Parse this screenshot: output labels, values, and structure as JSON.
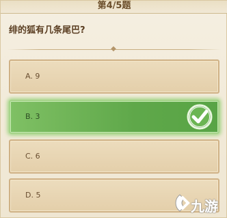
{
  "header": {
    "progress": "第4/5题"
  },
  "question": {
    "text": "绯的狐有几条尾巴?"
  },
  "options": [
    {
      "label": "A. 9",
      "correct": false
    },
    {
      "label": "B. 3",
      "correct": true
    },
    {
      "label": "C. 6",
      "correct": false
    },
    {
      "label": "D. 5",
      "correct": false
    }
  ],
  "watermark": {
    "text": "九游"
  },
  "colors": {
    "correct": "#5fa84a",
    "option_bg": "#e4cfaa",
    "text": "#5a3e22"
  },
  "icons": {
    "correct_mark": "checkmark-icon",
    "watermark_logo": "jiuyou-logo-icon"
  }
}
